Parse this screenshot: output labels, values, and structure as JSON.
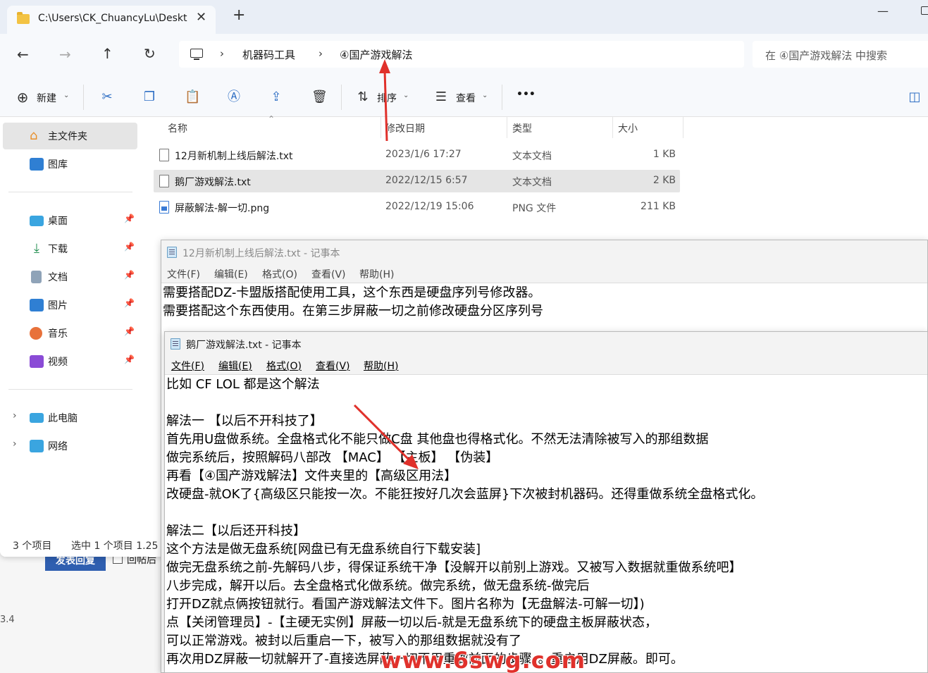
{
  "tab": {
    "title": "C:\\Users\\CK_ChuancyLu\\Deskt",
    "close": "✕",
    "new": "+"
  },
  "window_controls": {
    "minimize": "—"
  },
  "nav": {
    "back": "←",
    "forward": "→",
    "up": "↑",
    "refresh": "↻"
  },
  "address": {
    "sep": "›",
    "crumbs": [
      "机器码工具",
      "④国产游戏解法"
    ]
  },
  "search": {
    "placeholder": "在 ④国产游戏解法 中搜索"
  },
  "toolbar": {
    "new_label": "新建",
    "sort_label": "排序",
    "view_label": "查看",
    "more": "•••",
    "caret": "⌄"
  },
  "sidebar": {
    "home": "主文件夹",
    "gallery": "图库",
    "desktop": "桌面",
    "downloads": "下载",
    "documents": "文档",
    "pictures": "图片",
    "music": "音乐",
    "videos": "视频",
    "this_pc": "此电脑",
    "network": "网络",
    "pin": "📌",
    "expand": "›"
  },
  "columns": {
    "name": "名称",
    "date": "修改日期",
    "type": "类型",
    "size": "大小",
    "sort_arrow": "⌃"
  },
  "files": [
    {
      "name": "12月新机制上线后解法.txt",
      "date": "2023/1/6 17:27",
      "type": "文本文档",
      "size": "1 KB"
    },
    {
      "name": "鹅厂游戏解法.txt",
      "date": "2022/12/15 6:57",
      "type": "文本文档",
      "size": "2 KB"
    },
    {
      "name": "屏蔽解法-解一切.png",
      "date": "2022/12/19 15:06",
      "type": "PNG 文件",
      "size": "211 KB"
    }
  ],
  "status": {
    "count": "3 个项目",
    "selected": "选中 1 个项目  1.25"
  },
  "background_page": {
    "post_button": "发表回复",
    "checkbox_label": "回帖后",
    "version": "3.4"
  },
  "notepad1": {
    "title": "12月新机制上线后解法.txt - 记事本",
    "menus": [
      "文件(F)",
      "编辑(E)",
      "格式(O)",
      "查看(V)",
      "帮助(H)"
    ],
    "lines": [
      "需要搭配DZ-卡盟版搭配使用工具，这个东西是硬盘序列号修改器。",
      "需要搭配这个东西使用。在第三步屏蔽一切之前修改硬盘分区序列号"
    ]
  },
  "notepad2": {
    "title": "鹅厂游戏解法.txt - 记事本",
    "menus": [
      "文件(F)",
      "编辑(E)",
      "格式(O)",
      "查看(V)",
      "帮助(H)"
    ],
    "lines": [
      "比如 CF LOL 都是这个解法",
      "",
      "解法一 【以后不开科技了】",
      "首先用U盘做系统。全盘格式化不能只做C盘 其他盘也得格式化。不然无法清除被写入的那组数据",
      "做完系统后，按照解码八部改 【MAC】 【主板】 【伪装】",
      "再看【④国产游戏解法】文件夹里的【高级区用法】",
      "改硬盘-就OK了{高级区只能按一次。不能狂按好几次会蓝屏}下次被封机器码。还得重做系统全盘格式化。",
      "",
      "解法二【以后还开科技】",
      "这个方法是做无盘系统[网盘已有无盘系统自行下载安装]",
      "做完无盘系统之前-先解码八步，得保证系统干净【没解开以前别上游戏。又被写入数据就重做系统吧】",
      "八步完成，解开以后。去全盘格式化做系统。做完系统，做无盘系统-做完后",
      "打开DZ就点俩按钮就行。看国产游戏解法文件下。图片名称为【无盘解法-可解一切】)",
      "点【关闭管理员】-【主硬无实例】屏蔽一切以后-就是无盘系统下的硬盘主板屏蔽状态，",
      "可以正常游戏。被封以后重启一下，被写入的那组数据就没有了",
      "再次用DZ屏蔽一切就解开了-直接选屏蔽一切不用重做前面的步骤，。重启用DZ屏蔽。即可。"
    ]
  },
  "watermark": "www.6swg.com",
  "colors": {
    "accent": "#2f6fc4",
    "annotation": "#e0312b",
    "selection": "#e5e5e5"
  }
}
